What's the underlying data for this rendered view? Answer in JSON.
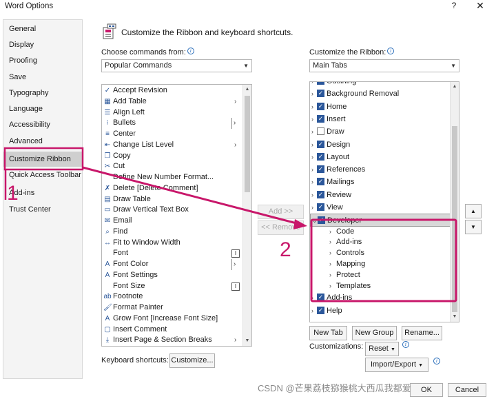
{
  "window": {
    "title": "Word Options",
    "help": "?",
    "close": "✕"
  },
  "nav": {
    "items": [
      "General",
      "Display",
      "Proofing",
      "Save",
      "Typography",
      "Language",
      "Accessibility",
      "Advanced",
      "Customize Ribbon",
      "Quick Access Toolbar",
      "Add-ins",
      "Trust Center"
    ],
    "selected": "Customize Ribbon"
  },
  "header": {
    "text": "Customize the Ribbon and keyboard shortcuts."
  },
  "commands": {
    "label": "Choose commands from:",
    "dropdown_value": "Popular Commands",
    "items": [
      {
        "label": "Accept Revision",
        "icon": "accept-revision-icon"
      },
      {
        "label": "Add Table",
        "icon": "table-icon",
        "submenu": true
      },
      {
        "label": "Align Left",
        "icon": "align-left-icon"
      },
      {
        "label": "Bullets",
        "icon": "bullets-icon",
        "split": true
      },
      {
        "label": "Center",
        "icon": "center-icon"
      },
      {
        "label": "Change List Level",
        "icon": "list-level-icon",
        "submenu": true
      },
      {
        "label": "Copy",
        "icon": "copy-icon"
      },
      {
        "label": "Cut",
        "icon": "cut-icon"
      },
      {
        "label": "Define New Number Format...",
        "icon": ""
      },
      {
        "label": "Delete [Delete Comment]",
        "icon": "delete-comment-icon"
      },
      {
        "label": "Draw Table",
        "icon": "draw-table-icon"
      },
      {
        "label": "Draw Vertical Text Box",
        "icon": "text-box-icon"
      },
      {
        "label": "Email",
        "icon": "email-icon"
      },
      {
        "label": "Find",
        "icon": "find-icon"
      },
      {
        "label": "Fit to Window Width",
        "icon": "fit-width-icon"
      },
      {
        "label": "Font",
        "icon": "",
        "field": true
      },
      {
        "label": "Font Color",
        "icon": "font-color-icon",
        "split": true
      },
      {
        "label": "Font Settings",
        "icon": "font-settings-icon"
      },
      {
        "label": "Font Size",
        "icon": "",
        "field": true
      },
      {
        "label": "Footnote",
        "icon": "footnote-icon"
      },
      {
        "label": "Format Painter",
        "icon": "format-painter-icon"
      },
      {
        "label": "Grow Font [Increase Font Size]",
        "icon": "grow-font-icon"
      },
      {
        "label": "Insert Comment",
        "icon": "insert-comment-icon"
      },
      {
        "label": "Insert Page & Section Breaks",
        "icon": "page-break-icon",
        "submenu": true
      }
    ]
  },
  "ribbon": {
    "label": "Customize the Ribbon:",
    "dropdown_value": "Main Tabs",
    "tabs": [
      {
        "label": "Outlining",
        "checked": true
      },
      {
        "label": "Background Removal",
        "checked": true
      },
      {
        "label": "Home",
        "checked": true
      },
      {
        "label": "Insert",
        "checked": true
      },
      {
        "label": "Draw",
        "checked": false
      },
      {
        "label": "Design",
        "checked": true
      },
      {
        "label": "Layout",
        "checked": true
      },
      {
        "label": "References",
        "checked": true
      },
      {
        "label": "Mailings",
        "checked": true
      },
      {
        "label": "Review",
        "checked": true
      },
      {
        "label": "View",
        "checked": true
      },
      {
        "label": "Developer",
        "checked": true,
        "selected": true
      }
    ],
    "developer_groups": [
      "Code",
      "Add-ins",
      "Controls",
      "Mapping",
      "Protect",
      "Templates"
    ],
    "after_tabs": [
      {
        "label": "Add-ins",
        "checked": true
      },
      {
        "label": "Help",
        "checked": true
      }
    ]
  },
  "buttons": {
    "add": "Add >>",
    "remove": "<< Remove",
    "new_tab": "New Tab",
    "new_group": "New Group",
    "rename": "Rename...",
    "customizations_label": "Customizations:",
    "reset": "Reset",
    "import_export": "Import/Export",
    "keyboard_label": "Keyboard shortcuts:",
    "customize": "Customize...",
    "ok": "OK",
    "cancel": "Cancel"
  },
  "annotations": {
    "step1": "1",
    "step2": "2",
    "color": "#c8176a"
  },
  "watermark": "CSDN @芒果荔枝猕猴桃大西瓜我都爱"
}
